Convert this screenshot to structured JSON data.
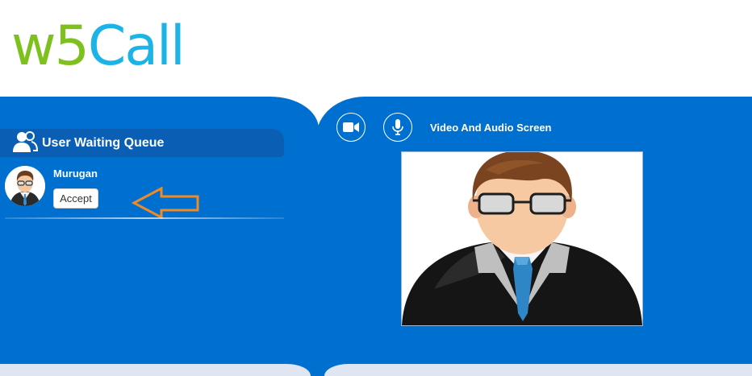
{
  "header": {
    "logo_w5": "w5",
    "logo_call": "Call"
  },
  "queue": {
    "title": "User Waiting Queue",
    "users": [
      {
        "name": "Murugan",
        "accept_label": "Accept"
      }
    ]
  },
  "video": {
    "title": "Video And Audio Screen"
  },
  "icons": {
    "queue": "users-icon",
    "camera": "video-camera-icon",
    "mic": "microphone-icon",
    "arrow": "arrow-left-icon"
  },
  "colors": {
    "panel": "#0070d0",
    "logo_green": "#7ec11e",
    "logo_blue": "#1cb3e6",
    "arrow": "#f08a24"
  }
}
